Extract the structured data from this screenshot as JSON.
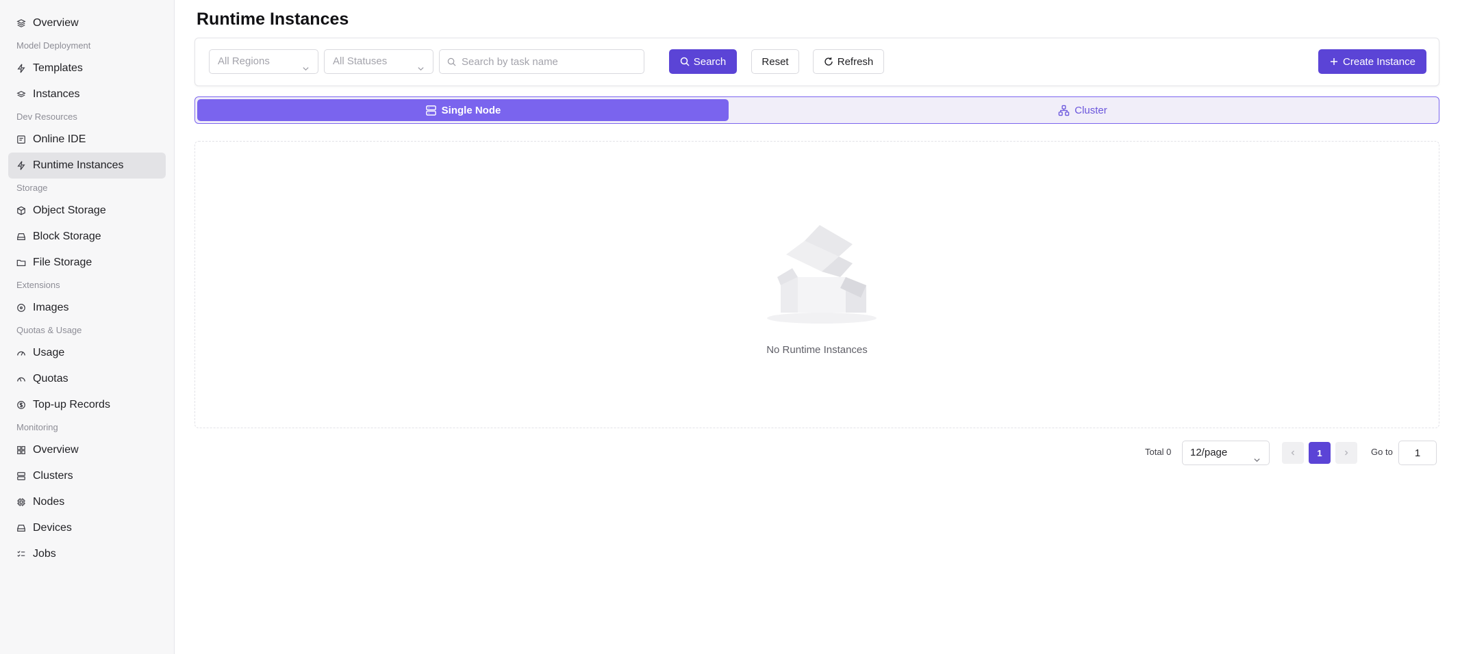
{
  "sidebar": {
    "top_item": {
      "label": "Overview",
      "icon": "layers-icon"
    },
    "sections": [
      {
        "title": "Model Deployment",
        "items": [
          {
            "label": "Templates",
            "icon": "bolt-icon"
          },
          {
            "label": "Instances",
            "icon": "stack-icon"
          }
        ]
      },
      {
        "title": "Dev Resources",
        "items": [
          {
            "label": "Online IDE",
            "icon": "ide-icon"
          },
          {
            "label": "Runtime Instances",
            "icon": "bolt-icon",
            "active": true
          }
        ]
      },
      {
        "title": "Storage",
        "items": [
          {
            "label": "Object Storage",
            "icon": "cube-icon"
          },
          {
            "label": "Block Storage",
            "icon": "drive-icon"
          },
          {
            "label": "File Storage",
            "icon": "folder-icon"
          }
        ]
      },
      {
        "title": "Extensions",
        "items": [
          {
            "label": "Images",
            "icon": "disc-icon"
          }
        ]
      },
      {
        "title": "Quotas & Usage",
        "items": [
          {
            "label": "Usage",
            "icon": "gauge-icon"
          },
          {
            "label": "Quotas",
            "icon": "gauge-icon"
          },
          {
            "label": "Top-up Records",
            "icon": "dollar-circle-icon"
          }
        ]
      },
      {
        "title": "Monitoring",
        "items": [
          {
            "label": "Overview",
            "icon": "dashboard-icon"
          },
          {
            "label": "Clusters",
            "icon": "server-icon"
          },
          {
            "label": "Nodes",
            "icon": "chip-icon"
          },
          {
            "label": "Devices",
            "icon": "drive-icon"
          },
          {
            "label": "Jobs",
            "icon": "checklist-icon"
          }
        ]
      }
    ]
  },
  "page": {
    "title": "Runtime Instances"
  },
  "filters": {
    "region_placeholder": "All Regions",
    "status_placeholder": "All Statuses",
    "search_placeholder": "Search by task name",
    "search_value": ""
  },
  "buttons": {
    "search": "Search",
    "reset": "Reset",
    "refresh": "Refresh",
    "create": "Create Instance"
  },
  "tabs": {
    "single": "Single Node",
    "cluster": "Cluster"
  },
  "empty": {
    "message": "No Runtime Instances"
  },
  "pagination": {
    "total": "Total 0",
    "page_size": "12/page",
    "current": "1",
    "goto_label": "Go to",
    "goto_value": "1"
  },
  "colors": {
    "accent": "#5b44d6",
    "tab_active": "#7a64ee",
    "sidebar_bg": "#f7f7f8"
  }
}
